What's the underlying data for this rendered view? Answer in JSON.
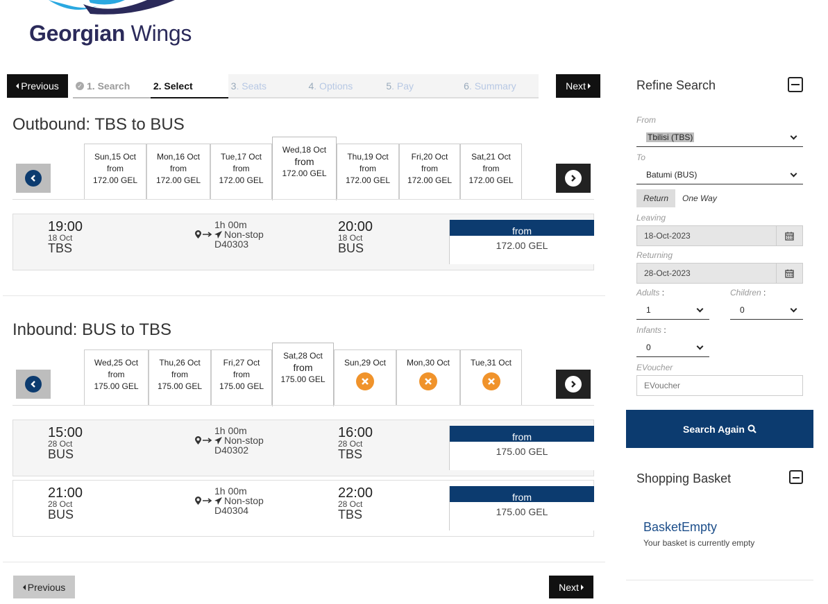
{
  "brand": {
    "name_first": "Georgian",
    "name_second": "Wings",
    "color": "#2b2a5a",
    "accent": "#2aa8e0"
  },
  "stepbar": {
    "previous_label": "Previous",
    "next_label": "Next",
    "steps": [
      {
        "num": "",
        "label": "1. Search",
        "state": "done"
      },
      {
        "num": "",
        "label": "2. Select",
        "state": "active"
      },
      {
        "num": "3",
        "label": ". Seats",
        "state": "future"
      },
      {
        "num": "4",
        "label": ". Options",
        "state": "future"
      },
      {
        "num": "5",
        "label": ". Pay",
        "state": "future"
      },
      {
        "num": "6",
        "label": ". Summary",
        "state": "future"
      }
    ]
  },
  "outbound": {
    "title": "Outbound: TBS to BUS",
    "dates": [
      {
        "day": "Sun,15 Oct",
        "from": "from",
        "price": "172.00 GEL"
      },
      {
        "day": "Mon,16 Oct",
        "from": "from",
        "price": "172.00 GEL"
      },
      {
        "day": "Tue,17 Oct",
        "from": "from",
        "price": "172.00 GEL"
      },
      {
        "day": "Wed,18 Oct",
        "from": "from",
        "price": "172.00 GEL",
        "selected": true
      },
      {
        "day": "Thu,19 Oct",
        "from": "from",
        "price": "172.00 GEL"
      },
      {
        "day": "Fri,20 Oct",
        "from": "from",
        "price": "172.00 GEL"
      },
      {
        "day": "Sat,21 Oct",
        "from": "from",
        "price": "172.00 GEL"
      }
    ],
    "flights": [
      {
        "dep_time": "19:00",
        "dep_date": "18 Oct",
        "dep_code": "TBS",
        "duration": "1h 00m",
        "stops": "Non-stop",
        "flight_no": "D40303",
        "arr_time": "20:00",
        "arr_date": "18 Oct",
        "arr_code": "BUS",
        "from": "from",
        "price": "172.00 GEL"
      }
    ]
  },
  "inbound": {
    "title": "Inbound: BUS to TBS",
    "dates": [
      {
        "day": "Wed,25 Oct",
        "from": "from",
        "price": "175.00 GEL"
      },
      {
        "day": "Thu,26 Oct",
        "from": "from",
        "price": "175.00 GEL"
      },
      {
        "day": "Fri,27 Oct",
        "from": "from",
        "price": "175.00 GEL"
      },
      {
        "day": "Sat,28 Oct",
        "from": "from",
        "price": "175.00 GEL",
        "selected": true
      },
      {
        "day": "Sun,29 Oct",
        "unavailable": true
      },
      {
        "day": "Mon,30 Oct",
        "unavailable": true
      },
      {
        "day": "Tue,31 Oct",
        "unavailable": true
      }
    ],
    "flights": [
      {
        "dep_time": "15:00",
        "dep_date": "28 Oct",
        "dep_code": "BUS",
        "duration": "1h 00m",
        "stops": "Non-stop",
        "flight_no": "D40302",
        "arr_time": "16:00",
        "arr_date": "28 Oct",
        "arr_code": "TBS",
        "from": "from",
        "price": "175.00 GEL"
      },
      {
        "dep_time": "21:00",
        "dep_date": "28 Oct",
        "dep_code": "BUS",
        "duration": "1h 00m",
        "stops": "Non-stop",
        "flight_no": "D40304",
        "arr_time": "22:00",
        "arr_date": "28 Oct",
        "arr_code": "TBS",
        "from": "from",
        "price": "175.00 GEL"
      }
    ]
  },
  "bottom_nav": {
    "previous_label": "Previous",
    "next_label": "Next"
  },
  "refine": {
    "title": "Refine Search",
    "from_label": "From",
    "from_value": "Tbilisi (TBS)",
    "to_label": "To",
    "to_value": "Batumi (BUS)",
    "return_label": "Return",
    "oneway_label": "One Way",
    "leaving_label": "Leaving",
    "leaving_value": "18-Oct-2023",
    "returning_label": "Returning",
    "returning_value": "28-Oct-2023",
    "adults_label": "Adults",
    "adults_value": "1",
    "children_label": "Children",
    "children_value": "0",
    "infants_label": "Infants",
    "infants_value": "0",
    "colon": ":",
    "evoucher_label": "EVoucher",
    "evoucher_placeholder": "EVoucher",
    "search_label": "Search Again"
  },
  "basket": {
    "title": "Shopping Basket",
    "empty_title": "BasketEmpty",
    "empty_msg": "Your basket is currently empty"
  },
  "colors": {
    "primary": "#0c3b6f",
    "warning": "#f0932b"
  }
}
